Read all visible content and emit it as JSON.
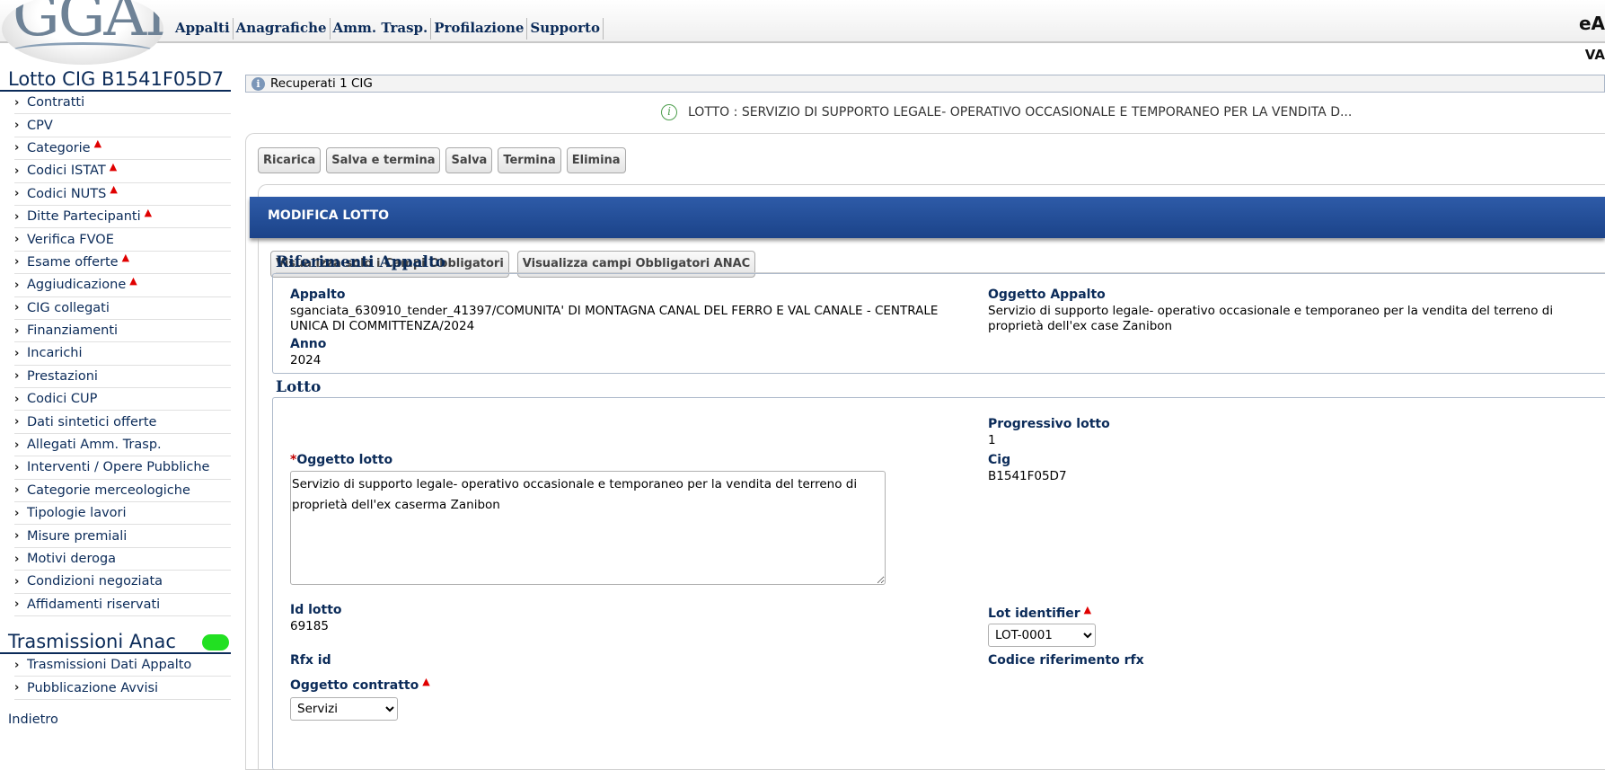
{
  "header": {
    "logo_text": "GGAP",
    "logo_reg": "®",
    "nav": [
      "Appalti",
      "Anagrafiche",
      "Amm. Trasp.",
      "Profilazione",
      "Supporto"
    ],
    "right_text": "eA",
    "right_text2": "VA"
  },
  "sidebar": {
    "title": "Lotto CIG B1541F05D7",
    "items": [
      {
        "label": "Contratti",
        "warn": false
      },
      {
        "label": "CPV",
        "warn": false
      },
      {
        "label": "Categorie",
        "warn": true
      },
      {
        "label": "Codici ISTAT",
        "warn": true
      },
      {
        "label": "Codici NUTS",
        "warn": true
      },
      {
        "label": "Ditte Partecipanti",
        "warn": true
      },
      {
        "label": "Verifica FVOE",
        "warn": false
      },
      {
        "label": "Esame offerte",
        "warn": true
      },
      {
        "label": "Aggiudicazione",
        "warn": true
      },
      {
        "label": "CIG collegati",
        "warn": false
      },
      {
        "label": "Finanziamenti",
        "warn": false
      },
      {
        "label": "Incarichi",
        "warn": false
      },
      {
        "label": "Prestazioni",
        "warn": false
      },
      {
        "label": "Codici CUP",
        "warn": false
      },
      {
        "label": "Dati sintetici offerte",
        "warn": false
      },
      {
        "label": "Allegati Amm. Trasp.",
        "warn": false
      },
      {
        "label": "Interventi / Opere Pubbliche",
        "warn": false
      },
      {
        "label": "Categorie merceologiche",
        "warn": false
      },
      {
        "label": "Tipologie lavori",
        "warn": false
      },
      {
        "label": "Misure premiali",
        "warn": false
      },
      {
        "label": "Motivi deroga",
        "warn": false
      },
      {
        "label": "Condizioni negoziata",
        "warn": false
      },
      {
        "label": "Affidamenti riservati",
        "warn": false
      }
    ],
    "title2": "Trasmissioni Anac",
    "status_color": "#22e022",
    "items2": [
      {
        "label": "Trasmissioni Dati Appalto"
      },
      {
        "label": "Pubblicazione Avvisi"
      }
    ],
    "back": "Indietro"
  },
  "main": {
    "info": "Recuperati 1 CIG",
    "lotto_msg": "LOTTO : SERVIZIO DI SUPPORTO LEGALE- OPERATIVO OCCASIONALE E TEMPORANEO PER LA VENDITA D...",
    "toolbar": [
      "Ricarica",
      "Salva e termina",
      "Salva",
      "Termina",
      "Elimina"
    ],
    "panel_title": "MODIFICA LOTTO",
    "vis_buttons": [
      "Visualizza solo i Campi Obbligatori",
      "Visualizza campi Obbligatori ANAC"
    ],
    "riferimenti": {
      "title": "Riferimenti Appalto",
      "appalto_label": "Appalto",
      "appalto_value": "sganciata_630910_tender_41397/COMUNITA' DI MONTAGNA CANAL DEL FERRO E VAL CANALE - CENTRALE UNICA DI COMMITTENZA/2024",
      "oggetto_label": "Oggetto Appalto",
      "oggetto_value": "Servizio di supporto legale- operativo occasionale e temporaneo per la vendita del terreno di proprietà dell'ex case Zanibon",
      "anno_label": "Anno",
      "anno_value": "2024"
    },
    "lotto": {
      "title": "Lotto",
      "progressivo_label": "Progressivo lotto",
      "progressivo_value": "1",
      "oggetto_lotto_req": "*",
      "oggetto_lotto_label": "Oggetto lotto",
      "oggetto_lotto_value": "Servizio di supporto legale- operativo occasionale e temporaneo per la vendita del terreno di proprietà dell'ex caserma Zanibon",
      "cig_label": "Cig",
      "cig_value": "B1541F05D7",
      "id_lotto_label": "Id lotto",
      "id_lotto_value": "69185",
      "lot_identifier_label": "Lot identifier",
      "lot_identifier_value": "LOT-0001",
      "rfx_label": "Rfx id",
      "codice_rfx_label": "Codice riferimento rfx",
      "oggetto_contratto_label": "Oggetto contratto",
      "oggetto_contratto_value": "Servizi"
    }
  }
}
